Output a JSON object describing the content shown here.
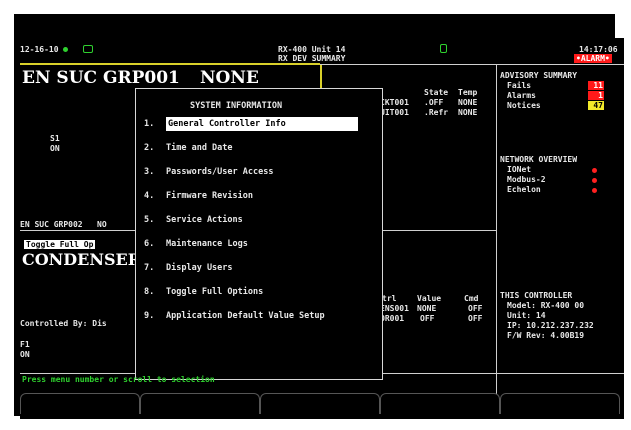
{
  "header": {
    "date": "12-16-10",
    "title_line1": "RX-400 Unit 14",
    "title_line2": "RX DEV SUMMARY",
    "time": "14:17:06",
    "alarm_label": "•ALARM•"
  },
  "left_panel": {
    "big_title": "EN SUC GRP001",
    "none_label": "NONE",
    "s1_label": "S1",
    "s1_state": "ON",
    "grp2_label": "EN SUC GRP002",
    "grp2_value": "NO",
    "toggle_label": "Toggle Full Op",
    "condenser_label": "CONDENSER",
    "controlled_by": "Controlled By: Dis",
    "f1_label": "F1",
    "f1_state": "ON"
  },
  "middle_table_top": {
    "headers": [
      "State",
      "Temp"
    ],
    "rows": [
      {
        "name": "CKT001",
        "state": ".OFF",
        "temp": "NONE"
      },
      {
        "name": "UIT001",
        "state": ".Refr",
        "temp": "NONE"
      }
    ]
  },
  "middle_table_bottom": {
    "headers": [
      "trl",
      "Value",
      "Cmd"
    ],
    "rows": [
      {
        "name": "ENS001",
        "value": "NONE",
        "cmd": "OFF"
      },
      {
        "name": "OR001",
        "value": "OFF",
        "cmd": "OFF"
      }
    ]
  },
  "advisory": {
    "title": "ADVISORY SUMMARY",
    "fails_label": "Fails",
    "fails_count": "11",
    "alarms_label": "Alarms",
    "alarms_count": "1",
    "notices_label": "Notices",
    "notices_count": "47"
  },
  "network": {
    "title": "NETWORK OVERVIEW",
    "items": [
      "IONet",
      "Modbus-2",
      "Echelon"
    ]
  },
  "controller": {
    "title": "THIS CONTROLLER",
    "model": "Model: RX-400  00",
    "unit": "Unit: 14",
    "ip": "IP: 10.212.237.232",
    "fw": "F/W Rev: 4.00B19"
  },
  "popup": {
    "title": "SYSTEM INFORMATION",
    "items": [
      {
        "num": "1.",
        "label": "General Controller Info"
      },
      {
        "num": "2.",
        "label": "Time and Date"
      },
      {
        "num": "3.",
        "label": "Passwords/User Access"
      },
      {
        "num": "4.",
        "label": "Firmware Revision"
      },
      {
        "num": "5.",
        "label": "Service Actions"
      },
      {
        "num": "6.",
        "label": "Maintenance Logs"
      },
      {
        "num": "7.",
        "label": "Display Users"
      },
      {
        "num": "8.",
        "label": "Toggle Full Options"
      },
      {
        "num": "9.",
        "label": "Application Default Value Setup"
      }
    ]
  },
  "status_bar": {
    "text": "Press menu number or scroll to selection"
  },
  "colors": {
    "alarm_red": "#ff1a1a",
    "notice_yellow": "#f2ea2a",
    "status_green": "#2fd12f",
    "frame_yellow": "#d9d02a"
  }
}
